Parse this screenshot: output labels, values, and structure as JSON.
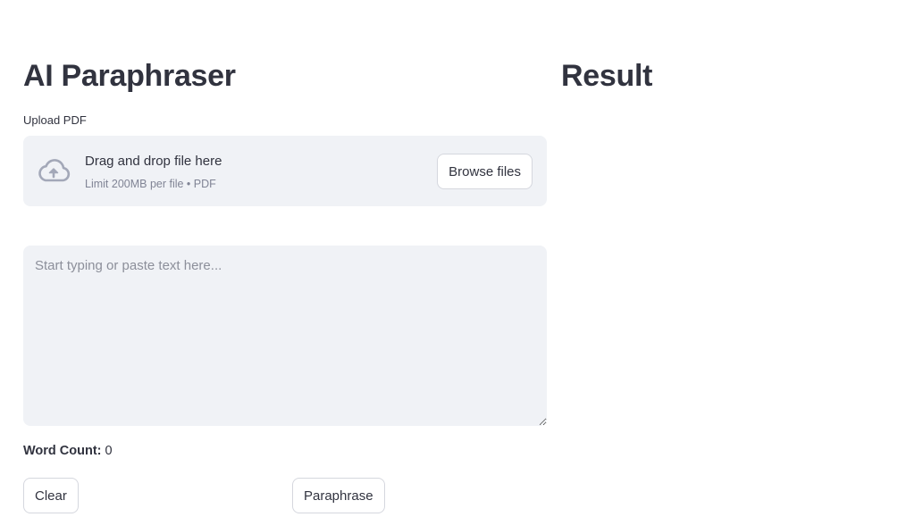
{
  "left": {
    "title": "AI Paraphraser",
    "upload": {
      "label": "Upload PDF",
      "drop_title": "Drag and drop file here",
      "drop_subtitle": "Limit 200MB per file • PDF",
      "browse_label": "Browse files",
      "icon": "cloud-upload-icon"
    },
    "input": {
      "value": "",
      "placeholder": "Start typing or paste text here..."
    },
    "word_count": {
      "label": "Word Count:",
      "value": "0"
    },
    "buttons": {
      "clear_label": "Clear",
      "paraphrase_label": "Paraphrase"
    }
  },
  "right": {
    "title": "Result"
  },
  "colors": {
    "text": "#31333f",
    "muted": "#808495",
    "panel_bg": "#f0f2f6",
    "icon": "#a3a8b8",
    "border": "#d5d7de"
  }
}
